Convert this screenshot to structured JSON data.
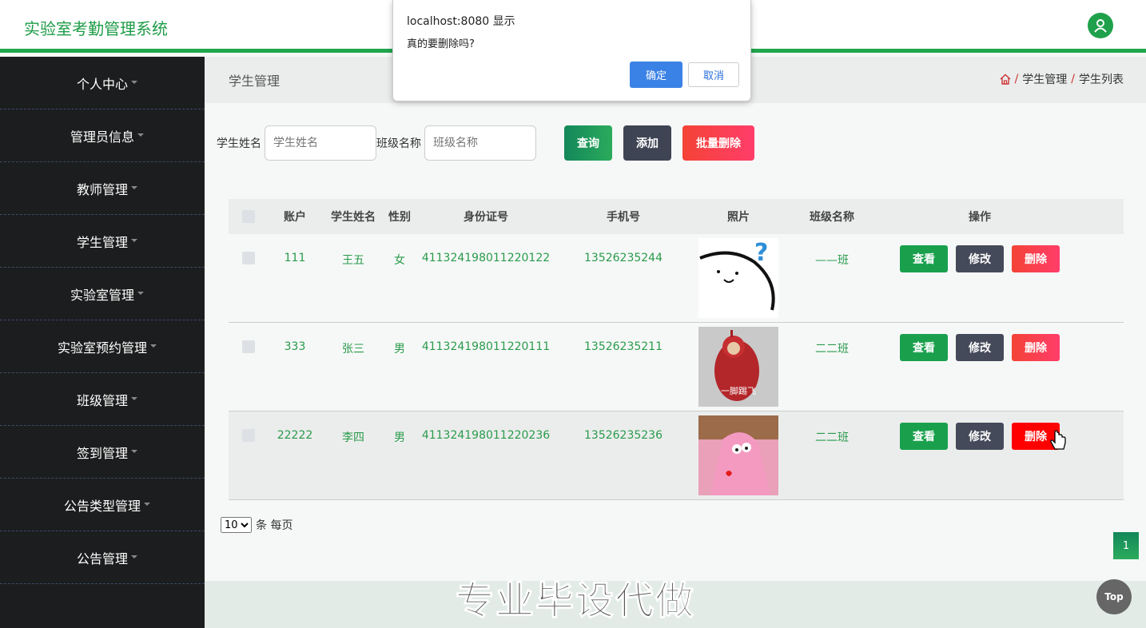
{
  "header": {
    "title": "实验室考勤管理系统",
    "avatar_icon": "user-icon"
  },
  "sidebar": {
    "items": [
      {
        "label": "个人中心"
      },
      {
        "label": "管理员信息"
      },
      {
        "label": "教师管理"
      },
      {
        "label": "学生管理"
      },
      {
        "label": "实验室管理"
      },
      {
        "label": "实验室预约管理"
      },
      {
        "label": "班级管理"
      },
      {
        "label": "签到管理"
      },
      {
        "label": "公告类型管理"
      },
      {
        "label": "公告管理"
      }
    ]
  },
  "page": {
    "title": "学生管理",
    "breadcrumb": [
      "学生管理",
      "学生列表"
    ],
    "breadcrumb_sep": "/"
  },
  "search": {
    "name_label": "学生姓名",
    "name_placeholder": "学生姓名",
    "class_label": "班级名称",
    "class_placeholder": "班级名称",
    "query_label": "查询",
    "add_label": "添加",
    "batch_delete_label": "批量删除"
  },
  "table": {
    "headers": [
      "账户",
      "学生姓名",
      "性别",
      "身份证号",
      "手机号",
      "照片",
      "班级名称",
      "操作"
    ],
    "rows": [
      {
        "account": "111",
        "name": "王五",
        "sex": "女",
        "id_no": "411324198011220122",
        "phone": "13526235244",
        "photo": "sticker-thinking",
        "class": "——班"
      },
      {
        "account": "333",
        "name": "张三",
        "sex": "男",
        "id_no": "411324198011220111",
        "phone": "13526235211",
        "photo": "sticker-teletubby",
        "photo_caption": "一脚踢飞",
        "class": "二二班"
      },
      {
        "account": "22222",
        "name": "李四",
        "sex": "男",
        "id_no": "411324198011220236",
        "phone": "13526235236",
        "photo": "sticker-patrick",
        "class": "二二班"
      }
    ],
    "ops": {
      "view": "查看",
      "edit": "修改",
      "delete": "删除"
    }
  },
  "pagination": {
    "page_size": "10",
    "page_size_suffix": "条 每页",
    "current_page": "1"
  },
  "watermark": "专业毕设代做",
  "top_button": "Top",
  "dialog": {
    "title": "localhost:8080 显示",
    "message": "真的要删除吗?",
    "ok": "确定",
    "cancel": "取消"
  },
  "colors": {
    "brand": "#21a64d",
    "sidebar": "#1c1d1e",
    "danger": "#ff0000",
    "primary": "#3b82e6"
  }
}
